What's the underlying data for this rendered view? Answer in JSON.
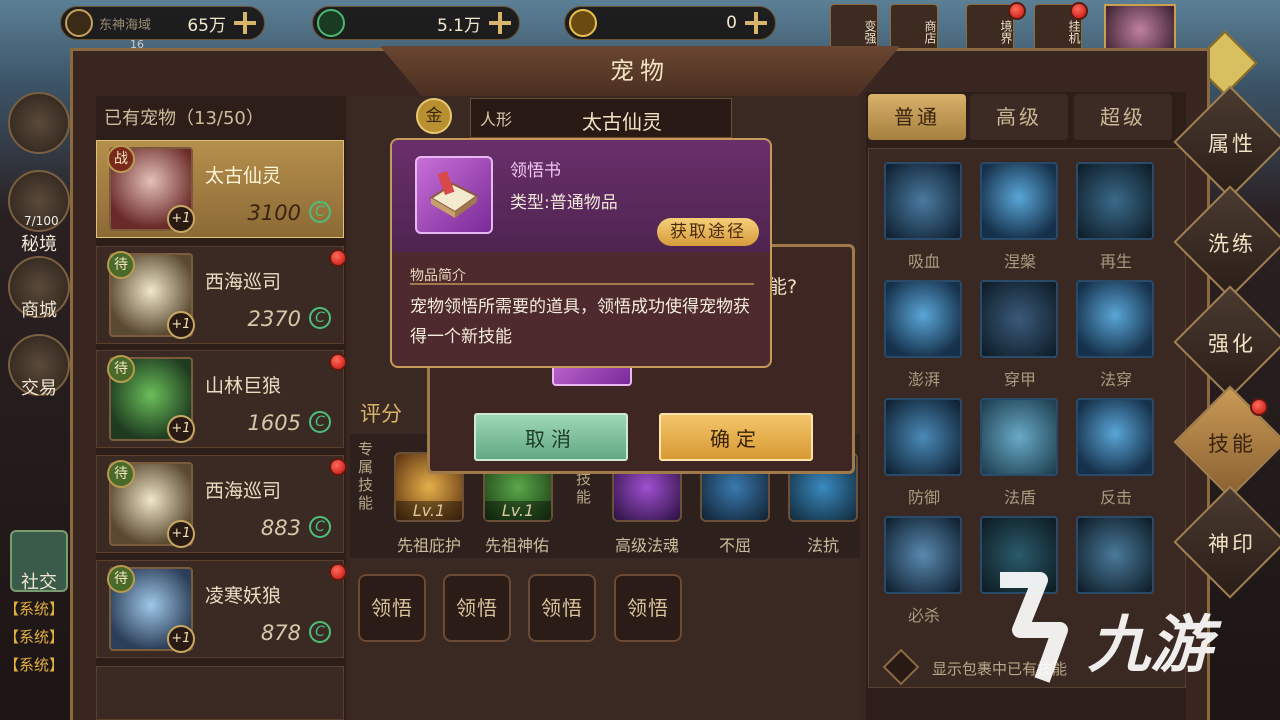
{
  "top_bar": {
    "res1_label": "东神海域",
    "res1_sub": "16",
    "res1_value": "65万",
    "res2_value": "5.1万",
    "res3_value": "0",
    "buttons": [
      "变强",
      "商店",
      "境界",
      "挂机"
    ]
  },
  "window": {
    "title": "宠物"
  },
  "pet_list": {
    "header": "已有宠物（13/50）",
    "pets": [
      {
        "tag": "战",
        "name": "太古仙灵",
        "power": "3100",
        "plus": "+1",
        "selected": true
      },
      {
        "tag": "待",
        "name": "西海巡司",
        "power": "2370",
        "plus": "+1",
        "selected": false
      },
      {
        "tag": "待",
        "name": "山林巨狼",
        "power": "1605",
        "plus": "+1",
        "selected": false
      },
      {
        "tag": "待",
        "name": "西海巡司",
        "power": "883",
        "plus": "+1",
        "selected": false
      },
      {
        "tag": "待",
        "name": "凌寒妖狼",
        "power": "878",
        "plus": "+1",
        "selected": false
      }
    ]
  },
  "center": {
    "badge": "金",
    "type_label": "人形",
    "pet_name": "太古仙灵",
    "rating_label": "评分",
    "exclusive_skill_label": "专属技能",
    "other_skill_label": "技能",
    "exclusive_skills": [
      {
        "name": "先祖庇护",
        "level": "Lv.1"
      },
      {
        "name": "先祖神佑",
        "level": "Lv.1"
      }
    ],
    "skills": [
      {
        "name": "高级法魂"
      },
      {
        "name": "不屈"
      },
      {
        "name": "法抗"
      }
    ],
    "learn_buttons": [
      "领悟",
      "领悟",
      "领悟",
      "领悟"
    ]
  },
  "right_panel": {
    "tabs": [
      {
        "label": "普通",
        "active": true
      },
      {
        "label": "高级",
        "active": false
      },
      {
        "label": "超级",
        "active": false
      }
    ],
    "skill_names": [
      "吸血",
      "涅槃",
      "再生",
      "澎湃",
      "穿甲",
      "法穿",
      "防御",
      "法盾",
      "反击",
      "必杀",
      "",
      "",
      ""
    ],
    "show_bag_label": "显示包裹中已有技能"
  },
  "side_tabs": [
    {
      "label": "属性",
      "active": false
    },
    {
      "label": "洗练",
      "active": false
    },
    {
      "label": "强化",
      "active": false
    },
    {
      "label": "技能",
      "active": true
    },
    {
      "label": "神印",
      "active": false
    }
  ],
  "left_side": {
    "items": [
      "秘境",
      "商城",
      "交易",
      "社交"
    ],
    "progress": "7/100",
    "system_msgs": [
      "【系统】",
      "【系统】",
      "【系统】"
    ]
  },
  "confirm_dialog": {
    "question_tail": "能?",
    "cancel": "取消",
    "ok": "确定"
  },
  "item_tip": {
    "name": "领悟书",
    "type": "类型:普通物品",
    "get_button": "获取途径",
    "section": "物品简介",
    "description": "宠物领悟所需要的道具，领悟成功使得宠物获得一个新技能"
  },
  "watermark": {
    "text": "九游"
  },
  "colors": {
    "accent_gold": "#d8b16a",
    "dialog_purple": "#6a2f6a",
    "ok_orange": "#f3c56a",
    "cancel_green": "#62a884"
  }
}
